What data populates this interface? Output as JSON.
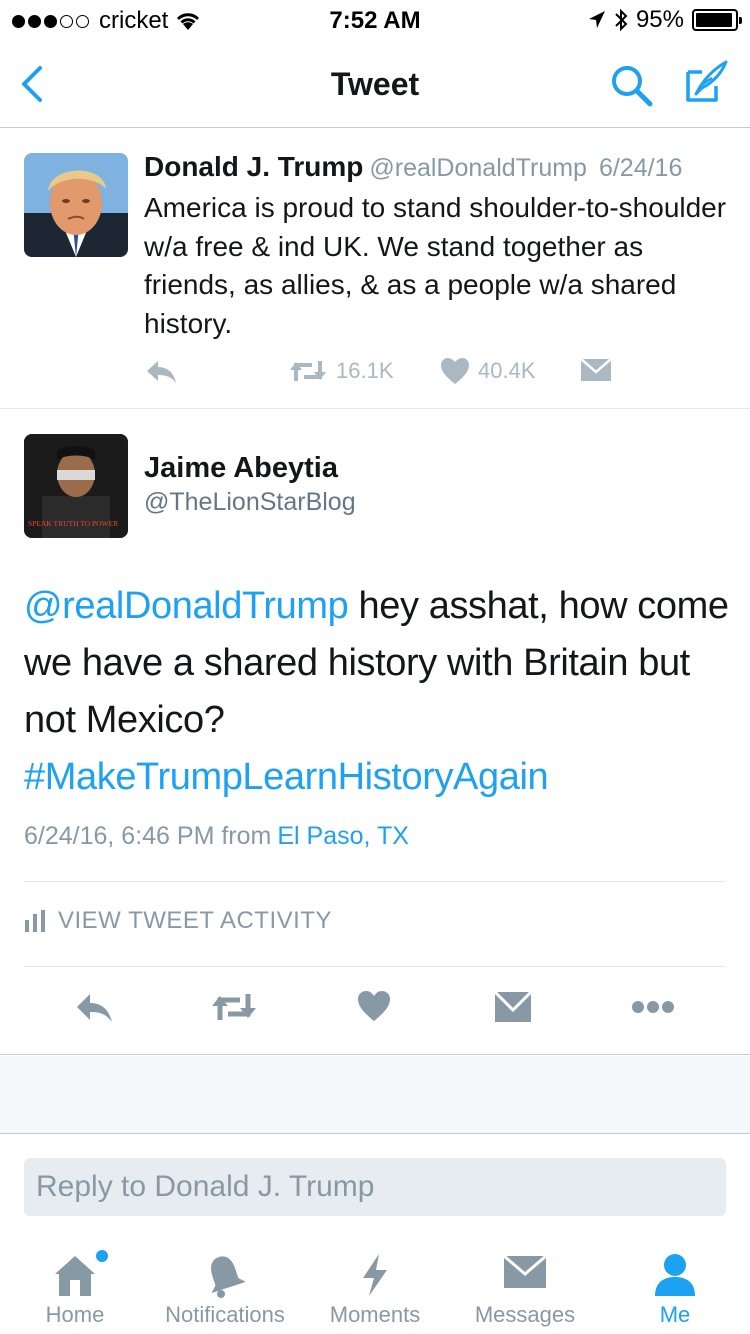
{
  "status_bar": {
    "carrier": "cricket",
    "time": "7:52 AM",
    "battery": "95%",
    "signal_bars_filled": 3,
    "signal_bars_total": 5
  },
  "nav": {
    "title": "Tweet",
    "back_icon": "chevron-left-icon",
    "search_icon": "search-icon",
    "compose_icon": "compose-tweet-icon"
  },
  "parent_tweet": {
    "name": "Donald J. Trump",
    "handle": "@realDonaldTrump",
    "date": "6/24/16",
    "text": "America is proud to stand shoulder-to-shoulder w/a free & ind UK. We stand together as friends, as allies, & as a people w/a shared history.",
    "retweets": "16.1K",
    "likes": "40.4K"
  },
  "main_tweet": {
    "name": "Jaime Abeytia",
    "handle": "@TheLionStarBlog",
    "avatar_caption": "SPEAK TRUTH TO POWER",
    "mention": "@realDonaldTrump",
    "text": " hey asshat, how come we have a shared history with Britain but not Mexico? ",
    "hashtag": "#MakeTrumpLearnHistoryAgain",
    "timestamp": "6/24/16, 6:46 PM from",
    "location": "El Paso, TX",
    "activity_label": "VIEW TWEET ACTIVITY"
  },
  "reply": {
    "placeholder": "Reply to Donald J. Trump"
  },
  "tabs": [
    {
      "label": "Home",
      "icon": "home-icon"
    },
    {
      "label": "Notifications",
      "icon": "bell-icon"
    },
    {
      "label": "Moments",
      "icon": "lightning-icon"
    },
    {
      "label": "Messages",
      "icon": "envelope-icon"
    },
    {
      "label": "Me",
      "icon": "person-icon"
    }
  ],
  "colors": {
    "accent": "#1da1f2",
    "muted": "#8899a6",
    "action_gray": "#aab8c2"
  }
}
